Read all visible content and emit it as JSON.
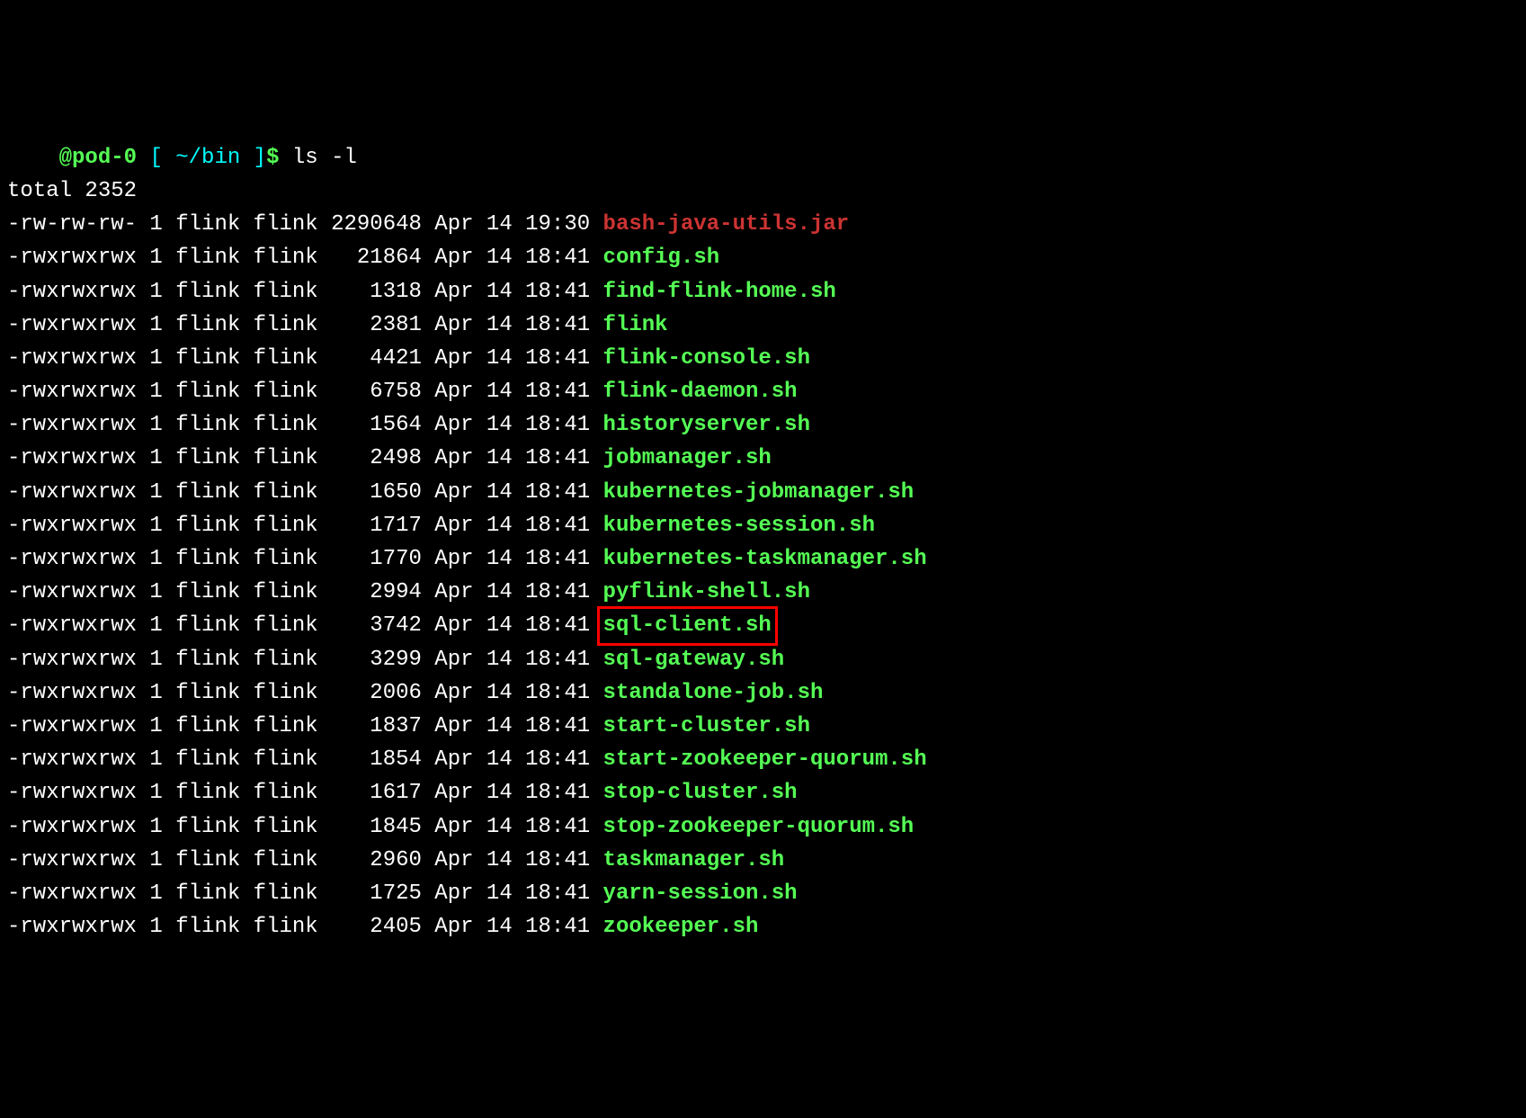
{
  "prompt": {
    "host": "@pod-0",
    "bracket_open": "[",
    "path": "~/bin",
    "bracket_close": "]",
    "dollar": "$",
    "command": "ls -l"
  },
  "total": "total 2352",
  "rows": [
    {
      "perms": "-rw-rw-rw-",
      "links": "1",
      "owner": "flink",
      "group": "flink",
      "size": "2290648",
      "month": "Apr",
      "day": "14",
      "time": "19:30",
      "name": "bash-java-utils.jar",
      "type": "regular",
      "highlighted": false
    },
    {
      "perms": "-rwxrwxrwx",
      "links": "1",
      "owner": "flink",
      "group": "flink",
      "size": "21864",
      "month": "Apr",
      "day": "14",
      "time": "18:41",
      "name": "config.sh",
      "type": "exec",
      "highlighted": false
    },
    {
      "perms": "-rwxrwxrwx",
      "links": "1",
      "owner": "flink",
      "group": "flink",
      "size": "1318",
      "month": "Apr",
      "day": "14",
      "time": "18:41",
      "name": "find-flink-home.sh",
      "type": "exec",
      "highlighted": false
    },
    {
      "perms": "-rwxrwxrwx",
      "links": "1",
      "owner": "flink",
      "group": "flink",
      "size": "2381",
      "month": "Apr",
      "day": "14",
      "time": "18:41",
      "name": "flink",
      "type": "exec",
      "highlighted": false
    },
    {
      "perms": "-rwxrwxrwx",
      "links": "1",
      "owner": "flink",
      "group": "flink",
      "size": "4421",
      "month": "Apr",
      "day": "14",
      "time": "18:41",
      "name": "flink-console.sh",
      "type": "exec",
      "highlighted": false
    },
    {
      "perms": "-rwxrwxrwx",
      "links": "1",
      "owner": "flink",
      "group": "flink",
      "size": "6758",
      "month": "Apr",
      "day": "14",
      "time": "18:41",
      "name": "flink-daemon.sh",
      "type": "exec",
      "highlighted": false
    },
    {
      "perms": "-rwxrwxrwx",
      "links": "1",
      "owner": "flink",
      "group": "flink",
      "size": "1564",
      "month": "Apr",
      "day": "14",
      "time": "18:41",
      "name": "historyserver.sh",
      "type": "exec",
      "highlighted": false
    },
    {
      "perms": "-rwxrwxrwx",
      "links": "1",
      "owner": "flink",
      "group": "flink",
      "size": "2498",
      "month": "Apr",
      "day": "14",
      "time": "18:41",
      "name": "jobmanager.sh",
      "type": "exec",
      "highlighted": false
    },
    {
      "perms": "-rwxrwxrwx",
      "links": "1",
      "owner": "flink",
      "group": "flink",
      "size": "1650",
      "month": "Apr",
      "day": "14",
      "time": "18:41",
      "name": "kubernetes-jobmanager.sh",
      "type": "exec",
      "highlighted": false
    },
    {
      "perms": "-rwxrwxrwx",
      "links": "1",
      "owner": "flink",
      "group": "flink",
      "size": "1717",
      "month": "Apr",
      "day": "14",
      "time": "18:41",
      "name": "kubernetes-session.sh",
      "type": "exec",
      "highlighted": false
    },
    {
      "perms": "-rwxrwxrwx",
      "links": "1",
      "owner": "flink",
      "group": "flink",
      "size": "1770",
      "month": "Apr",
      "day": "14",
      "time": "18:41",
      "name": "kubernetes-taskmanager.sh",
      "type": "exec",
      "highlighted": false
    },
    {
      "perms": "-rwxrwxrwx",
      "links": "1",
      "owner": "flink",
      "group": "flink",
      "size": "2994",
      "month": "Apr",
      "day": "14",
      "time": "18:41",
      "name": "pyflink-shell.sh",
      "type": "exec",
      "highlighted": false
    },
    {
      "perms": "-rwxrwxrwx",
      "links": "1",
      "owner": "flink",
      "group": "flink",
      "size": "3742",
      "month": "Apr",
      "day": "14",
      "time": "18:41",
      "name": "sql-client.sh",
      "type": "exec",
      "highlighted": true
    },
    {
      "perms": "-rwxrwxrwx",
      "links": "1",
      "owner": "flink",
      "group": "flink",
      "size": "3299",
      "month": "Apr",
      "day": "14",
      "time": "18:41",
      "name": "sql-gateway.sh",
      "type": "exec",
      "highlighted": false
    },
    {
      "perms": "-rwxrwxrwx",
      "links": "1",
      "owner": "flink",
      "group": "flink",
      "size": "2006",
      "month": "Apr",
      "day": "14",
      "time": "18:41",
      "name": "standalone-job.sh",
      "type": "exec",
      "highlighted": false
    },
    {
      "perms": "-rwxrwxrwx",
      "links": "1",
      "owner": "flink",
      "group": "flink",
      "size": "1837",
      "month": "Apr",
      "day": "14",
      "time": "18:41",
      "name": "start-cluster.sh",
      "type": "exec",
      "highlighted": false
    },
    {
      "perms": "-rwxrwxrwx",
      "links": "1",
      "owner": "flink",
      "group": "flink",
      "size": "1854",
      "month": "Apr",
      "day": "14",
      "time": "18:41",
      "name": "start-zookeeper-quorum.sh",
      "type": "exec",
      "highlighted": false
    },
    {
      "perms": "-rwxrwxrwx",
      "links": "1",
      "owner": "flink",
      "group": "flink",
      "size": "1617",
      "month": "Apr",
      "day": "14",
      "time": "18:41",
      "name": "stop-cluster.sh",
      "type": "exec",
      "highlighted": false
    },
    {
      "perms": "-rwxrwxrwx",
      "links": "1",
      "owner": "flink",
      "group": "flink",
      "size": "1845",
      "month": "Apr",
      "day": "14",
      "time": "18:41",
      "name": "stop-zookeeper-quorum.sh",
      "type": "exec",
      "highlighted": false
    },
    {
      "perms": "-rwxrwxrwx",
      "links": "1",
      "owner": "flink",
      "group": "flink",
      "size": "2960",
      "month": "Apr",
      "day": "14",
      "time": "18:41",
      "name": "taskmanager.sh",
      "type": "exec",
      "highlighted": false
    },
    {
      "perms": "-rwxrwxrwx",
      "links": "1",
      "owner": "flink",
      "group": "flink",
      "size": "1725",
      "month": "Apr",
      "day": "14",
      "time": "18:41",
      "name": "yarn-session.sh",
      "type": "exec",
      "highlighted": false
    },
    {
      "perms": "-rwxrwxrwx",
      "links": "1",
      "owner": "flink",
      "group": "flink",
      "size": "2405",
      "month": "Apr",
      "day": "14",
      "time": "18:41",
      "name": "zookeeper.sh",
      "type": "exec",
      "highlighted": false
    }
  ]
}
